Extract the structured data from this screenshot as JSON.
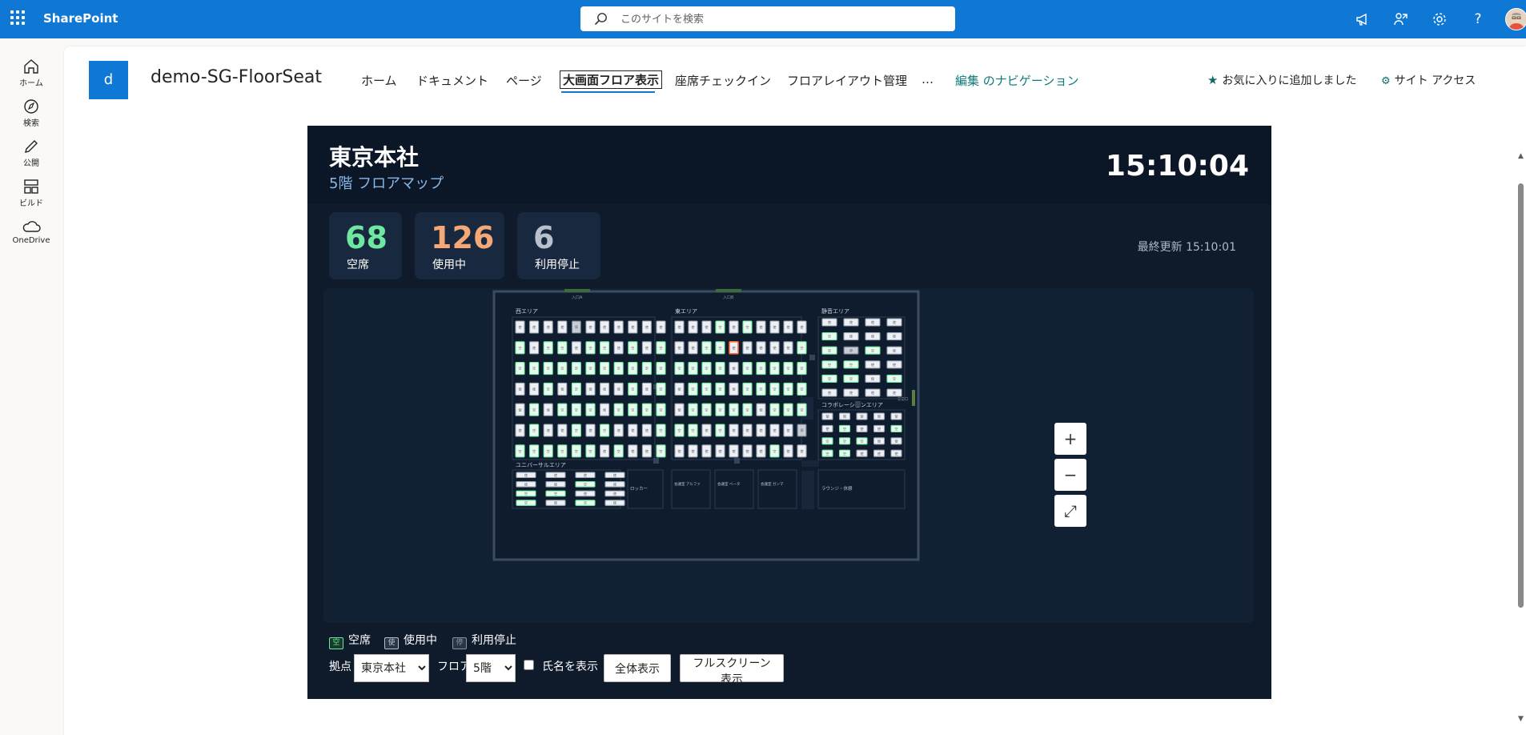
{
  "suitebar": {
    "brand": "SharePoint",
    "search_placeholder": "このサイトを検索",
    "icons": [
      "megaphone-icon",
      "people-share-icon",
      "settings-icon",
      "help-icon"
    ],
    "help_glyph": "?"
  },
  "appbar": {
    "items": [
      {
        "label": "ホーム",
        "icon": "home-icon"
      },
      {
        "label": "検索",
        "icon": "search-icon"
      },
      {
        "label": "公開",
        "icon": "pen-icon"
      },
      {
        "label": "ビルド",
        "icon": "layout-icon"
      },
      {
        "label": "OneDrive",
        "icon": "cloud-icon"
      }
    ]
  },
  "site": {
    "logo_letter": "d",
    "title": "demo-SG-FloorSeat",
    "nav": [
      "ホーム",
      "ドキュメント",
      "ページ",
      "大画面フロア表示",
      "座席チェックイン",
      "フロアレイアウト管理",
      "…",
      "編集 のナビゲーション"
    ],
    "favorite": "お気に入りに追加しました",
    "site_access": "サイト アクセス"
  },
  "dashboard": {
    "office": "東京本社",
    "floor_label": "5階 フロアマップ",
    "clock": "15:10:04",
    "stats": [
      {
        "value": "68",
        "label": "空席",
        "color": "#6ee7a0"
      },
      {
        "value": "126",
        "label": "使用中",
        "color": "#f4a777"
      },
      {
        "value": "6",
        "label": "利用停止",
        "color": "#b8c0cc"
      }
    ],
    "last_updated": "最終更新 15:10:01",
    "zoom": {
      "in": "+",
      "out": "−",
      "fit": "⤢"
    },
    "legend": [
      {
        "mark": "空",
        "label": "空席",
        "color": "#6ee7a0"
      },
      {
        "mark": "使",
        "label": "使用中",
        "color": "#b8c0cc"
      },
      {
        "mark": "停",
        "label": "利用停止",
        "color": "#8a93a3"
      }
    ],
    "controls": {
      "location_label": "拠点",
      "location_value": "東京本社",
      "floor_label": "フロア",
      "floor_value": "5階",
      "show_names_label": "氏名を表示",
      "show_all_button": "全体表示",
      "fullscreen_button": "フルスクリーン表示"
    }
  },
  "floormap": {
    "entrance_labels": [
      "入口A",
      "入口B"
    ],
    "areas": {
      "west": "西エリア",
      "east": "東エリア",
      "quiet": "静音エリア",
      "collab": "コラボレーションエリア",
      "universal": "ユニバーサルエリア"
    },
    "rooms": [
      "ロッカー",
      "会議室 アルファ",
      "会議室 ベータ",
      "会議室 ガンマ",
      "ラウンジ・休憩"
    ],
    "side_label": "非常口",
    "colors": {
      "vacant_border": "#6ee7a0",
      "vacant_fill": "#e9fbef",
      "occupied_border": "#9aa4b2",
      "occupied_fill": "#eef0f4",
      "stopped_border": "#6b7585",
      "stopped_fill": "#c8ccd4",
      "highlight_border": "#ff6a3d"
    },
    "seat_marks": {
      "vacant": "空",
      "occupied": "使",
      "stopped": "停"
    },
    "west_status": [
      "ooooxoooooo",
      "vovvovvovov",
      "vvvvvvvvvvv",
      "oovovooovov",
      "ovovvvovvvv",
      "ovoovovooov",
      "vvvvvvovoov"
    ],
    "east_status": [
      "ooovovoooo",
      "oovvhoooov",
      "vvvvovvvvv",
      "ovvvovvvvv",
      "ovvvvvovvv",
      "vvovooooox",
      "ooooooovoo"
    ],
    "quiet_status": [
      "oooo",
      "vooo",
      "vxvo",
      "vvoo",
      "vvov",
      "oooo"
    ],
    "collab_status": [
      "ooooo",
      "ovoov",
      "vvvoo",
      "vvooo"
    ],
    "universal_status": [
      "oooo",
      "oovo",
      "vvoo",
      "vovo"
    ]
  }
}
